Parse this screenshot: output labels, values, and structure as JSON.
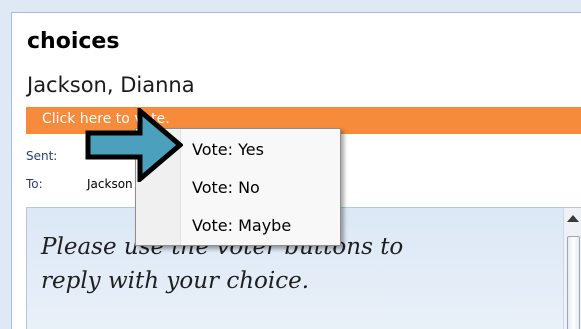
{
  "message": {
    "subject": "choices",
    "sender": "Jackson, Dianna",
    "infobar": "Click here to vote.",
    "sent_label": "Sent:",
    "sent_value": "",
    "to_label": "To:",
    "to_value": "Jackson",
    "body": "Please use the voter buttons to\nreply with your choice."
  },
  "vote_menu": {
    "items": [
      {
        "label": "Vote: Yes"
      },
      {
        "label": "Vote: No"
      },
      {
        "label": "Vote: Maybe"
      }
    ]
  },
  "icons": {
    "pointer": "arrow-pointer-icon",
    "scroll_up": "chevron-up-icon"
  },
  "colors": {
    "infobar": "#f58b3b",
    "arrow_fill": "#4aa0bd",
    "arrow_outline": "#000000"
  }
}
